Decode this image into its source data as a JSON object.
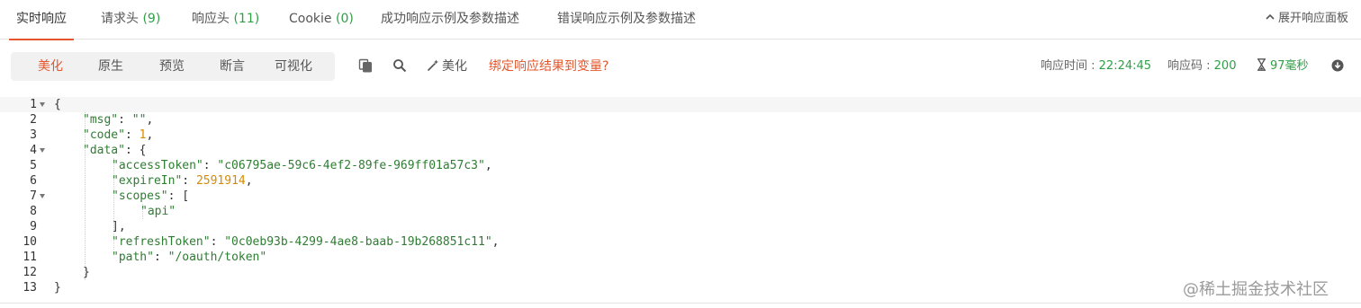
{
  "tabs": [
    {
      "label": "实时响应",
      "count": ""
    },
    {
      "label": "请求头",
      "count": "(9)"
    },
    {
      "label": "响应头",
      "count": "(11)"
    },
    {
      "label": "Cookie",
      "count": "(0)"
    },
    {
      "label": "成功响应示例及参数描述",
      "count": ""
    },
    {
      "label": "错误响应示例及参数描述",
      "count": ""
    }
  ],
  "expand_panel_label": "展开响应面板",
  "view_modes": [
    "美化",
    "原生",
    "预览",
    "断言",
    "可视化"
  ],
  "active_view_mode": "美化",
  "toolbar": {
    "beautify_label": "美化",
    "bind_link": "绑定响应结果到变量?",
    "icons": [
      "copy-icon",
      "search-icon",
      "magic-wand-icon",
      "hourglass-icon",
      "download-icon"
    ]
  },
  "meta": {
    "time_label": "响应时间 :",
    "time_value": "22:24:45",
    "code_label": "响应码 :",
    "code_value": "200",
    "duration_value": "97毫秒"
  },
  "code_lines": [
    {
      "num": "1",
      "text": "{"
    },
    {
      "num": "2",
      "key": "msg",
      "value": "\"\"",
      "vtype": "s",
      "comma": true
    },
    {
      "num": "3",
      "key": "code",
      "value": "1",
      "vtype": "n",
      "comma": true
    },
    {
      "num": "4",
      "key": "data",
      "value": "{"
    },
    {
      "num": "5",
      "key": "accessToken",
      "value": "\"c06795ae-59c6-4ef2-89fe-969ff01a57c3\"",
      "vtype": "s",
      "comma": true
    },
    {
      "num": "6",
      "key": "expireIn",
      "value": "2591914",
      "vtype": "n",
      "comma": true
    },
    {
      "num": "7",
      "key": "scopes",
      "value": "["
    },
    {
      "num": "8",
      "text": "\"api\"",
      "vtype": "s"
    },
    {
      "num": "9",
      "text": "],"
    },
    {
      "num": "10",
      "key": "refreshToken",
      "value": "\"0c0eb93b-4299-4ae8-baab-19b268851c11\"",
      "vtype": "s",
      "comma": true
    },
    {
      "num": "11",
      "key": "path",
      "value": "\"/oauth/token\"",
      "vtype": "s"
    },
    {
      "num": "12",
      "text": "}"
    },
    {
      "num": "13",
      "text": "}"
    }
  ],
  "colors": {
    "accent": "#e4572e",
    "count_green": "#2e9f45",
    "json_string": "#2e7d32",
    "json_number": "#d98a00"
  },
  "watermark": "@稀土掘金技术社区"
}
